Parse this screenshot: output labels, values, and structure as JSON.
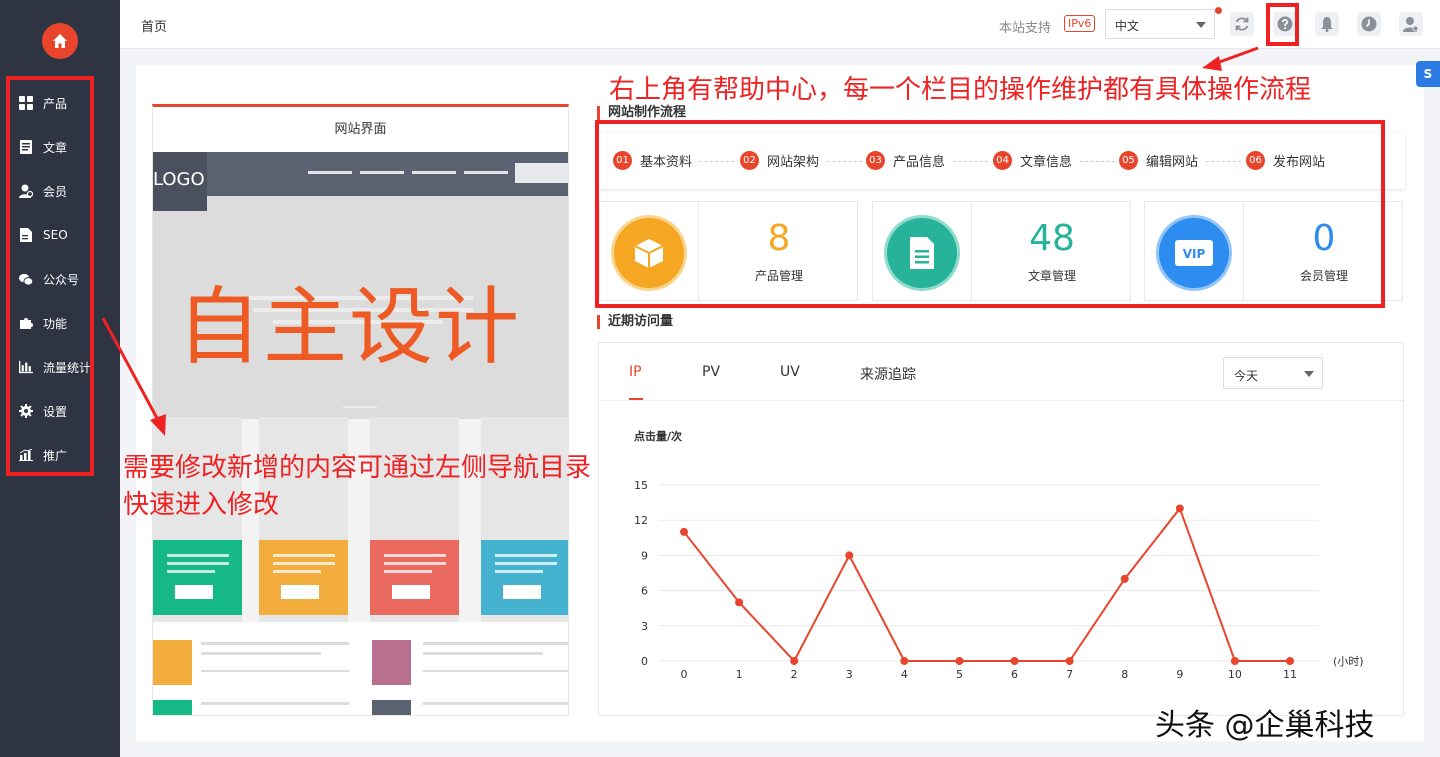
{
  "sidebar": {
    "items": [
      {
        "label": "产品",
        "icon": "grid-icon"
      },
      {
        "label": "文章",
        "icon": "document-icon"
      },
      {
        "label": "会员",
        "icon": "member-icon"
      },
      {
        "label": "SEO",
        "icon": "seo-file-icon"
      },
      {
        "label": "公众号",
        "icon": "wechat-icon"
      },
      {
        "label": "功能",
        "icon": "puzzle-icon"
      },
      {
        "label": "流量统计",
        "icon": "bar-chart-icon"
      },
      {
        "label": "设置",
        "icon": "gear-icon"
      },
      {
        "label": "推广",
        "icon": "promotion-chart-icon"
      }
    ]
  },
  "header": {
    "breadcrumb": "首页",
    "support_text": "本站支持",
    "ipv6_badge": "IPv6",
    "language": "中文"
  },
  "preview": {
    "title": "网站界面",
    "logo_text": "LOGO",
    "hero_text": "自主设计"
  },
  "process": {
    "title": "网站制作流程",
    "steps": [
      {
        "num": "01",
        "label": "基本资料"
      },
      {
        "num": "02",
        "label": "网站架构"
      },
      {
        "num": "03",
        "label": "产品信息"
      },
      {
        "num": "04",
        "label": "文章信息"
      },
      {
        "num": "05",
        "label": "编辑网站"
      },
      {
        "num": "06",
        "label": "发布网站"
      }
    ]
  },
  "stats": [
    {
      "value": "8",
      "label": "产品管理",
      "color": "#f5a623"
    },
    {
      "value": "48",
      "label": "文章管理",
      "color": "#26b39a"
    },
    {
      "value": "0",
      "label": "会员管理",
      "color": "#2d8cf0"
    }
  ],
  "visits": {
    "title": "近期访问量",
    "tabs": [
      "IP",
      "PV",
      "UV",
      "来源追踪"
    ],
    "active_tab": "IP",
    "range": "今天"
  },
  "chart_data": {
    "type": "line",
    "ylabel": "点击量/次",
    "xlabel": "(小时)",
    "x": [
      0,
      1,
      2,
      3,
      4,
      5,
      6,
      7,
      8,
      9,
      10,
      11
    ],
    "series": [
      {
        "values": [
          11,
          5,
          0,
          9,
          0,
          0,
          0,
          0,
          7,
          13,
          0,
          0
        ]
      }
    ],
    "yticks": [
      0,
      3,
      6,
      9,
      12,
      15
    ],
    "ylim": [
      0,
      15
    ],
    "grid": true,
    "color": "#e8452c"
  },
  "annotations": {
    "top_right": "右上角有帮助中心，每一个栏目的操作维护都有具体操作流程",
    "left_line1": "需要修改新增的内容可通过左侧导航目录",
    "left_line2": "快速进入修改"
  },
  "watermark": "头条 @企巢科技",
  "colors": {
    "accent": "#e8452c",
    "sidebar": "#2e3442",
    "annotation": "#ee2222"
  }
}
